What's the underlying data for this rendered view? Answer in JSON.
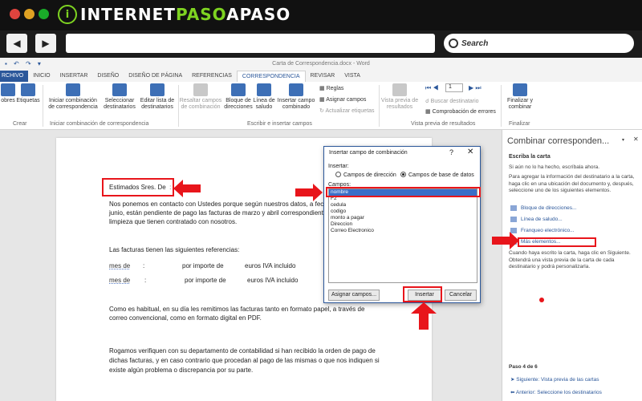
{
  "site": {
    "logo_letter": "i",
    "logo_white_1": "INTERNET",
    "logo_green": "PASO",
    "logo_white_2": "APASO"
  },
  "browser": {
    "back_icon": "arrow-left-icon",
    "forward_icon": "arrow-right-icon",
    "search_placeholder": "Search",
    "traffic_colors": [
      "#e0443e",
      "#dea123",
      "#1aab29"
    ]
  },
  "word": {
    "title": "Carta de Correspondencia.docx - Word",
    "quick_access": "▪ ↶ ↷ ▾"
  },
  "tabs": [
    {
      "label": "RCHIVO"
    },
    {
      "label": "INICIO"
    },
    {
      "label": "INSERTAR"
    },
    {
      "label": "DISEÑO"
    },
    {
      "label": "DISEÑO DE PÁGINA"
    },
    {
      "label": "REFERENCIAS"
    },
    {
      "label": "CORRESPONDENCIA",
      "active": true
    },
    {
      "label": "REVISAR"
    },
    {
      "label": "VISTA"
    }
  ],
  "ribbon": {
    "sobres": "obres",
    "etiquetas": "Etiquetas",
    "group_crear": "Crear",
    "iniciar_1": "Iniciar combinación",
    "iniciar_2": "de correspondencia",
    "seleccionar_1": "Seleccionar",
    "seleccionar_2": "destinatarios",
    "editar_1": "Editar lista de",
    "editar_2": "destinatarios",
    "group_iniciar": "Iniciar combinación de correspondencia",
    "resaltar_1": "Resaltar campos",
    "resaltar_2": "de combinación",
    "bloque_1": "Bloque de",
    "bloque_2": "direcciones",
    "linea_1": "Línea de",
    "linea_2": "saludo",
    "insertar_1": "Insertar campo",
    "insertar_2": "combinado",
    "reglas": "Reglas",
    "asignar": "Asignar campos",
    "actualizar": "Actualizar etiquetas",
    "group_escribir": "Escribir e insertar campos",
    "vista_1": "Vista previa de",
    "vista_2": "resultados",
    "record_number": "1",
    "buscar": "Buscar destinatario",
    "comprobacion": "Comprobación de errores",
    "group_vista": "Vista previa de resultados",
    "finalizar_1": "Finalizar y",
    "finalizar_2": "combinar",
    "group_finalizar": "Finalizar"
  },
  "document": {
    "greeting": "Estimados Sres. De",
    "p1_l1": "Nos ponemos en contacto con Ustedes porque según nuestros datos, a fecha",
    "p1_l2": "junio, están pendiente de pago las facturas de marzo y abril correspondient",
    "p1_l3": "limpieza que tienen contratado con nosotros.",
    "p2": "Las facturas tienen las siguientes referencias:",
    "row1_mes": "mes de",
    "row1_colon": ":",
    "row1_importe": "por importe de",
    "row1_euros": "euros IVA incluido",
    "row2_mes": "mes de",
    "row2_colon": ":",
    "row2_importe": "por importe de",
    "row2_euros": "euros IVA incluido",
    "p3_l1": "Como es habitual, en su día les remitimos las facturas tanto en formato papel, a través de",
    "p3_l2": "correo convencional, como en formato digital en PDF.",
    "p4_l1": "Rogamos verifiquen con su departamento de contabilidad si han recibido la orden de pago de",
    "p4_l2": "dichas facturas, y en caso contrario que procedan al pago de las mismas o que nos indiquen si",
    "p4_l3": "existe algún problema o discrepancia por su parte."
  },
  "dialog": {
    "title": "Insertar campo de combinación",
    "help": "?",
    "close": "✕",
    "insertar_label": "Insertar:",
    "radio_direccion": "Campos de dirección",
    "radio_base": "Campos de base de datos",
    "campos_label": "Campos:",
    "fields": [
      "nombre",
      "F2",
      "cedula",
      "codigo",
      "monto a pagar",
      "Direccion",
      "Correo Electronico"
    ],
    "asignar_btn": "Asignar campos...",
    "insertar_btn": "Insertar",
    "cancelar_btn": "Cancelar"
  },
  "pane": {
    "title": "Combinar corresponden...",
    "dropdown": "▾",
    "close": "✕",
    "subtitle": "Escriba la carta",
    "t1": "Si aún no lo ha hecho, escríbala ahora.",
    "t2": "Para agregar la información del destinatario a la carta, haga clic en una ubicación del documento y, después, seleccione uno de los siguientes elementos.",
    "link1": "Bloque de direcciones...",
    "link2": "Línea de saludo...",
    "link3": "Franqueo electrónico...",
    "link4": "Más elementos...",
    "t3": "Cuando haya escrito la carta, haga clic en Siguiente. Obtendrá una vista previa de la carta de cada destinatario y podrá personalizarla.",
    "step": "Paso 4 de 6",
    "next": "Siguiente: Vista previa de las cartas",
    "prev": "Anterior: Seleccione los destinatarios"
  },
  "annotation_color": "#e8151b"
}
